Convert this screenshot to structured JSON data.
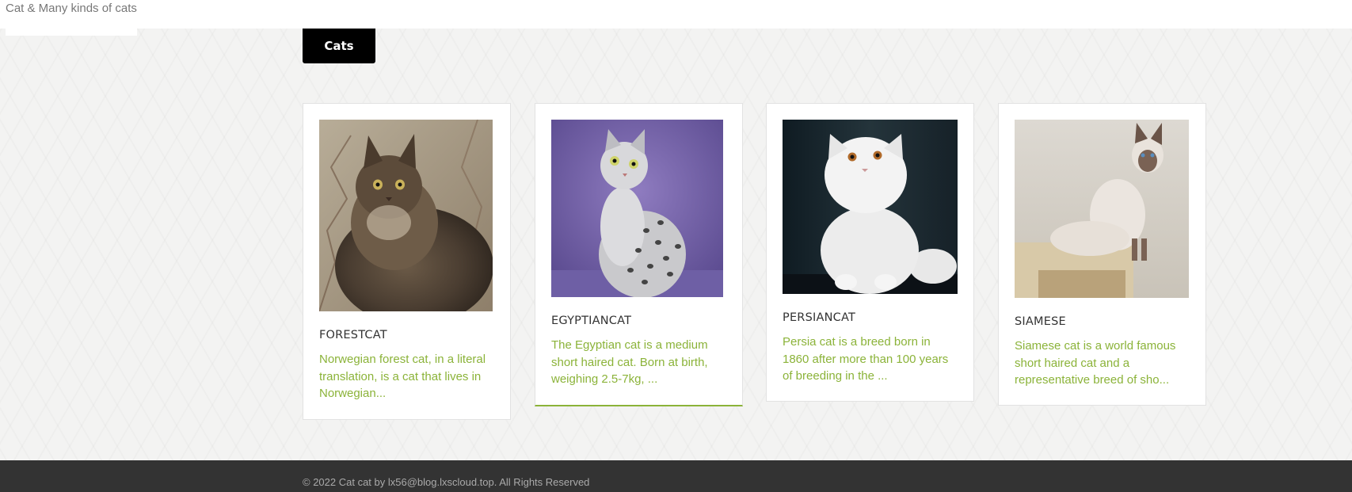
{
  "site": {
    "title": "Cat & Many kinds of cats"
  },
  "nav": {
    "active_tab": "Cats"
  },
  "cards": [
    {
      "name": "FORESTCAT",
      "description": "Norwegian forest cat, in a literal translation, is a cat that lives in Norwegian...",
      "image_icon": "long-haired-tabby-cat-photo"
    },
    {
      "name": "EGYPTIANCAT",
      "description": "The Egyptian cat is a medium short haired cat. Born at birth, weighing 2.5-7kg, ...",
      "image_icon": "spotted-silver-cat-photo"
    },
    {
      "name": "PERSIANCAT",
      "description": "Persia cat is a breed born in 1860 after more than 100 years of breeding in the ...",
      "image_icon": "white-persian-cat-photo"
    },
    {
      "name": "SIAMESE",
      "description": "Siamese cat is a world famous short haired cat and a representative breed of sho...",
      "image_icon": "siamese-cat-photo"
    }
  ],
  "footer": {
    "copyright": "© 2022 Cat cat by lx56@blog.lxscloud.top. All Rights Reserved"
  },
  "colors": {
    "accent": "#8bb339",
    "footer_bg": "#333333",
    "tab_bg": "#000000"
  }
}
